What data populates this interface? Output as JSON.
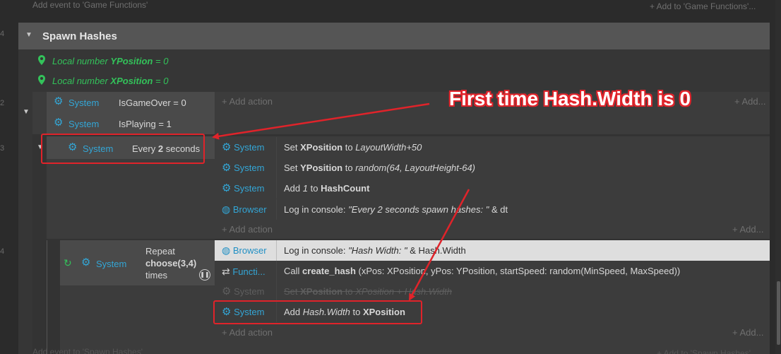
{
  "top_bar": {
    "add_event_label": "Add event to 'Game Functions'",
    "add_to_label": "+ Add to 'Game Functions'..."
  },
  "gutter": {
    "n1": "4",
    "n2": "2",
    "n3": "3",
    "n4": "4"
  },
  "group": {
    "title": "Spawn Hashes"
  },
  "locals": [
    {
      "prefix": "Local number",
      "name": "YPosition",
      "value": "= 0"
    },
    {
      "prefix": "Local number",
      "name": "XPosition",
      "value": "= 0"
    }
  ],
  "event1": {
    "conditions": [
      {
        "object": "System",
        "text": "IsGameOver = 0"
      },
      {
        "object": "System",
        "text": "IsPlaying = 1"
      }
    ],
    "add_action": "+ Add action",
    "add_more": "+ Add..."
  },
  "event2": {
    "condition": {
      "object": "System",
      "text_pre": "Every",
      "text_bold": "2",
      "text_post": "seconds"
    },
    "actions": [
      {
        "object": "System",
        "pre": "Set",
        "bold": "XPosition",
        "mid": "to",
        "ital": "LayoutWidth+50"
      },
      {
        "object": "System",
        "pre": "Set",
        "bold": "YPosition",
        "mid": "to",
        "ital": "random(64, LayoutHeight-64)"
      },
      {
        "object": "System",
        "pre": "Add",
        "ital": "1",
        "mid": "to",
        "bold": "HashCount"
      },
      {
        "object": "Browser",
        "pre": "Log in console:",
        "ital": "\"Every 2 seconds spawn hashes: \"",
        "post": "& dt"
      }
    ],
    "add_action": "+ Add action",
    "add_more": "+ Add..."
  },
  "event3": {
    "condition": {
      "object": "System",
      "line1": "Repeat",
      "line2": "choose(3,4)",
      "line3": "times"
    },
    "actions": [
      {
        "object": "Browser",
        "pre": "Log in console:",
        "ital": "\"Hash Width: \"",
        "post": "& Hash.Width"
      },
      {
        "object": "Functi...",
        "pre": "Call",
        "bold": "create_hash",
        "args": "(xPos: XPosition, yPos: YPosition, startSpeed: random(MinSpeed, MaxSpeed))"
      },
      {
        "object": "System",
        "pre": "Set",
        "bold": "XPosition",
        "mid": "to",
        "ital": "XPosition + Hash.Width"
      },
      {
        "object": "System",
        "pre": "Add",
        "ital": "Hash.Width",
        "mid": "to",
        "bold": "XPosition"
      }
    ],
    "add_action": "+ Add action",
    "add_more": "+ Add..."
  },
  "bottom_bar": {
    "add_event_label": "Add event to 'Spawn Hashes'",
    "add_to_label": "+ Add to 'Spawn Hashes'..."
  },
  "annotation": {
    "text": "First time Hash.Width is 0"
  },
  "colors": {
    "accent_red": "#e0232a",
    "system_blue": "#33a6d6",
    "local_green": "#33c25a"
  }
}
